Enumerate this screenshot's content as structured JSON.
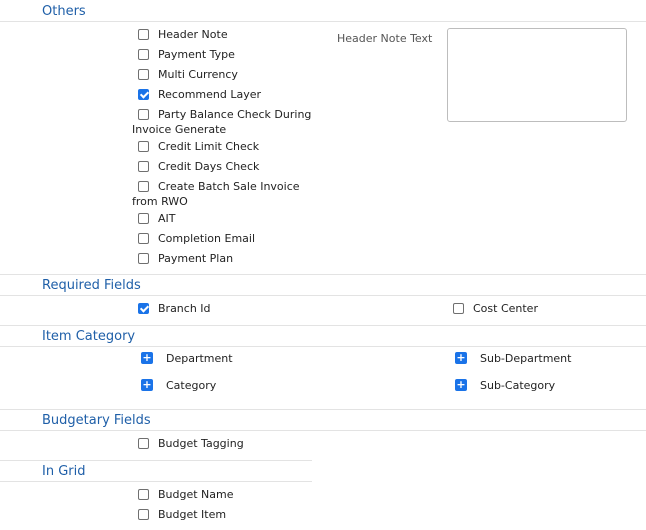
{
  "sections": {
    "others": {
      "title": "Others",
      "items": [
        {
          "label": "Header Note",
          "checked": false
        },
        {
          "label": "Payment Type",
          "checked": false
        },
        {
          "label": "Multi Currency",
          "checked": false
        },
        {
          "label": "Recommend Layer",
          "checked": true
        },
        {
          "label": "Party Balance Check During",
          "continuation": "Invoice Generate",
          "checked": false
        },
        {
          "label": "Credit Limit Check",
          "checked": false
        },
        {
          "label": "Credit Days Check",
          "checked": false
        },
        {
          "label": "Create Batch Sale Invoice",
          "continuation": "from RWO",
          "checked": false
        },
        {
          "label": "AIT",
          "checked": false
        },
        {
          "label": "Completion Email",
          "checked": false
        },
        {
          "label": "Payment Plan",
          "checked": false
        }
      ],
      "header_note_label": "Header Note Text",
      "header_note_value": ""
    },
    "required_fields": {
      "title": "Required Fields",
      "items": [
        {
          "label": "Branch Id",
          "checked": true
        },
        {
          "label": "Cost Center",
          "checked": false
        }
      ]
    },
    "item_category": {
      "title": "Item Category",
      "items": [
        {
          "label": "Department",
          "icon": "plus-icon"
        },
        {
          "label": "Sub-Department",
          "icon": "plus-icon"
        },
        {
          "label": "Category",
          "icon": "plus-icon"
        },
        {
          "label": "Sub-Category",
          "icon": "plus-icon"
        }
      ]
    },
    "budgetary_fields": {
      "title": "Budgetary Fields",
      "items": [
        {
          "label": "Budget Tagging",
          "checked": false
        }
      ]
    },
    "in_grid": {
      "title": "In Grid",
      "items": [
        {
          "label": "Budget Name",
          "checked": false
        },
        {
          "label": "Budget Item",
          "checked": false
        }
      ]
    }
  },
  "colors": {
    "section_title": "#1f5fa8",
    "accent": "#1a73e8",
    "divider": "#e3e3e3"
  }
}
